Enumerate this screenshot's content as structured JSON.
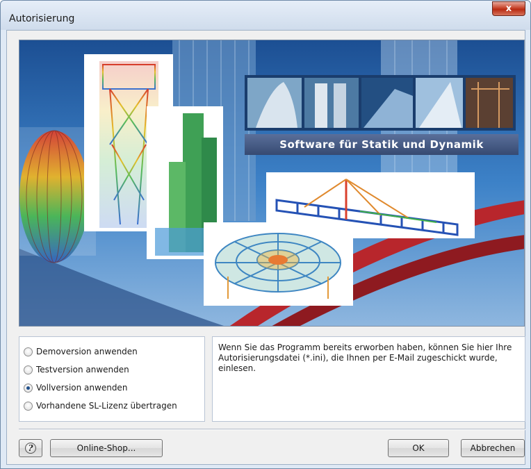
{
  "window": {
    "title": "Autorisierung",
    "close_glyph": "x"
  },
  "banner": {
    "caption": "Software für Statik und Dynamik"
  },
  "options": [
    {
      "label": "Demoversion anwenden",
      "checked": false
    },
    {
      "label": "Testversion anwenden",
      "checked": false
    },
    {
      "label": "Vollversion anwenden",
      "checked": true
    },
    {
      "label": "Vorhandene SL-Lizenz übertragen",
      "checked": false
    }
  ],
  "info": {
    "text": "Wenn Sie das Programm bereits erworben haben, können Sie hier Ihre Autorisierungsdatei (*.ini), die Ihnen per E-Mail zugeschickt wurde, einlesen."
  },
  "buttons": {
    "help_glyph": "?",
    "shop": "Online-Shop...",
    "ok": "OK",
    "cancel": "Abbrechen"
  },
  "colors": {
    "close_red": "#c7452c",
    "banner_sky": "#2f6fb4",
    "caption_bg": "#4a5f8a"
  }
}
